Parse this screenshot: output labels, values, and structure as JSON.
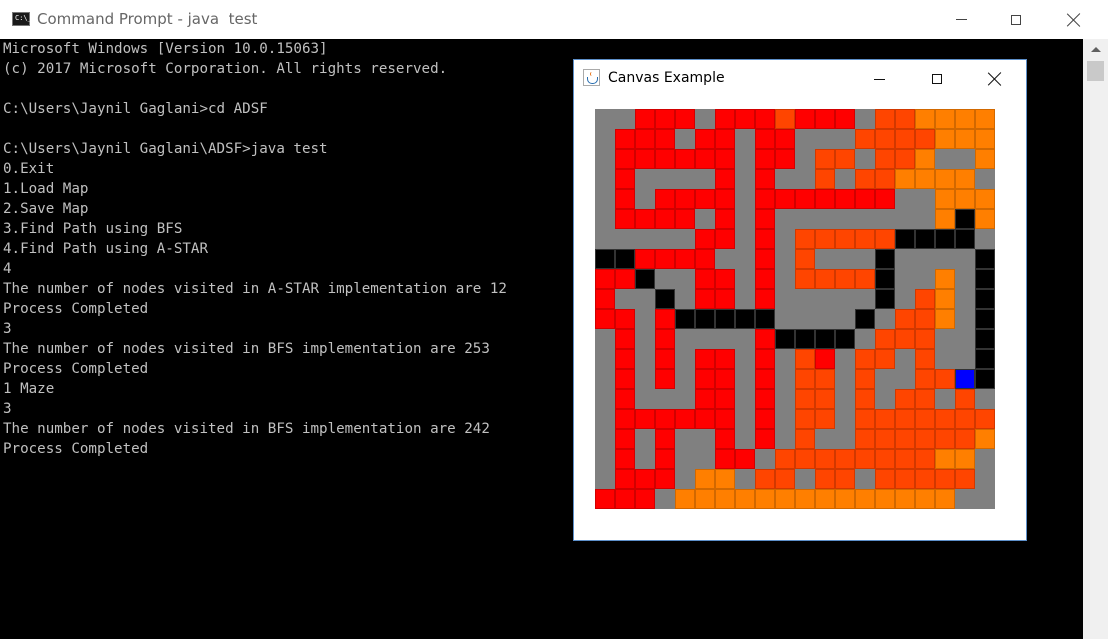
{
  "cmd_window": {
    "title": "Command Prompt - java  test",
    "console_lines": [
      "Microsoft Windows [Version 10.0.15063]",
      "(c) 2017 Microsoft Corporation. All rights reserved.",
      "",
      "C:\\Users\\Jaynil Gaglani>cd ADSF",
      "",
      "C:\\Users\\Jaynil Gaglani\\ADSF>java test",
      "0.Exit",
      "1.Load Map",
      "2.Save Map",
      "3.Find Path using BFS",
      "4.Find Path using A-STAR",
      "4",
      "The number of nodes visited in A-STAR implementation are 12",
      "Process Completed",
      "3",
      "The number of nodes visited in BFS implementation are 253",
      "Process Completed",
      "1 Maze",
      "3",
      "The number of nodes visited in BFS implementation are 242",
      "Process Completed"
    ]
  },
  "canvas_window": {
    "title": "Canvas Example",
    "maze": {
      "legend": {
        "W": "wall-grey",
        "R": "visited-red",
        "O": "visited-orange-red",
        "A": "visited-orange",
        "B": "path-black",
        "U": "target-blue"
      },
      "colors": {
        "W": "#808080",
        "R": "#ff0000",
        "O": "#ff4500",
        "A": "#ff7f00",
        "B": "#000000",
        "U": "#0000ff"
      },
      "rows": [
        "WWRRRWRRRORRRWOOAAAA",
        "WRRRWRRWRRWWWOOOOAAA",
        "WRRRRRRWRRWOOWOOAWWA",
        "WRWWWWRWRWWOWOOAAAAW",
        "WRWRRRRWRRRRRRRWWAAA",
        "WRRRRWRWRWWWWWWWWABA",
        "WWWWWRRWRWOOOOOBBBBW",
        "BBRRRRWWRWOWWWBWWWWB",
        "RRBWWRRWRWOOOOBWWAWB",
        "RWWBWRRWRWWWWWBWOAWB",
        "RRWRBBBBBWWWWBWOOAWB",
        "WRWRWWWWRBBBBWOOOWWB",
        "WRWRWRRWRWORWOOWOWWB",
        "WRWRWRRWRWOOWOWWOOUB",
        "WRWWWRRWRWOOWOWOOWOW",
        "WRRRRRRWRWOOWOOOOOOO",
        "WRWRWWRWRWOWWOOOOOOA",
        "WRWRWWRRWOOOOOOOOAAW",
        "WRRRWAAWOOWOOWOOOOOW",
        "RRRWAAAAAAAAAAAAAAWW"
      ]
    }
  }
}
